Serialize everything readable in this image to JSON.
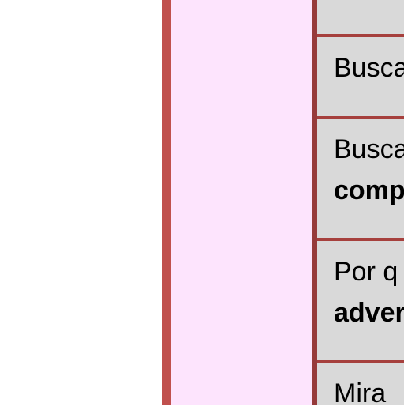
{
  "table": {
    "rows": [
      {
        "line1": "",
        "line2": ""
      },
      {
        "line1": "Busca",
        "line2": ""
      },
      {
        "line1": "Busca",
        "line2": "comp"
      },
      {
        "line1": "Por q",
        "line2": "adver"
      },
      {
        "line1": "Mira",
        "line2": ""
      }
    ]
  },
  "colors": {
    "accent_bar": "#c0504d",
    "side_column": "#fde4fd",
    "border": "#963a3a",
    "cell": "#d9d9d9"
  }
}
